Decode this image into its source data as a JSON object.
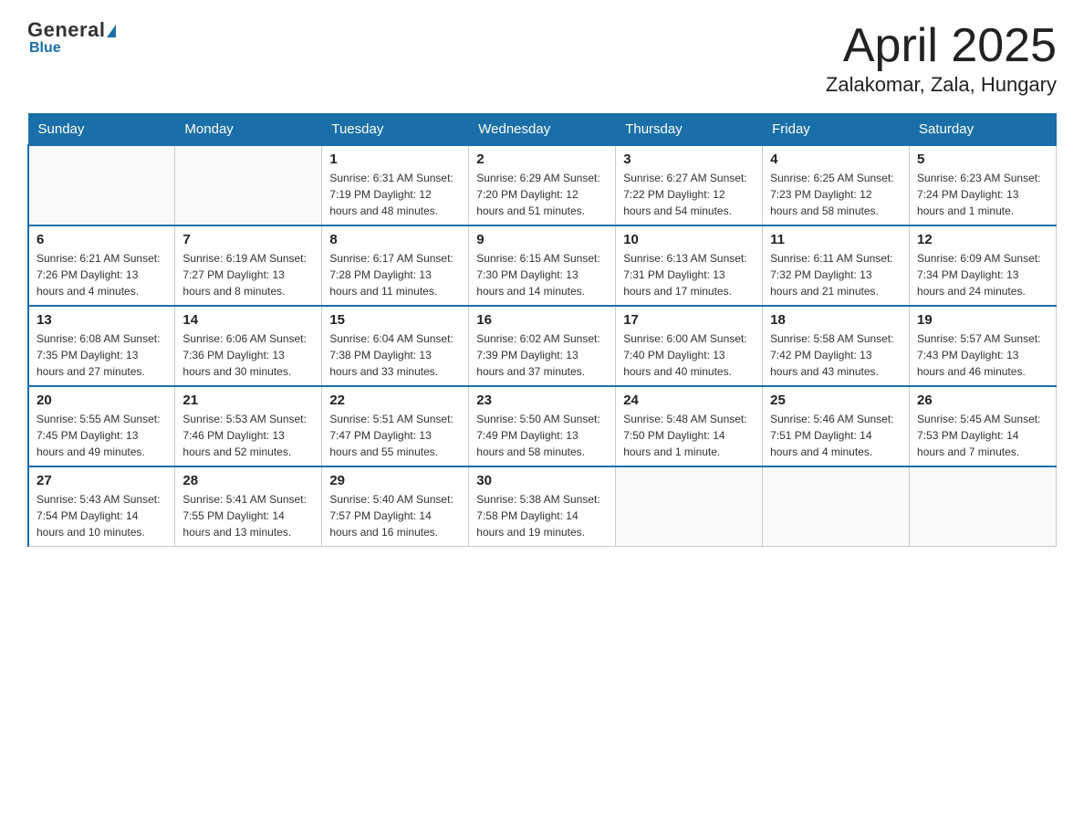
{
  "header": {
    "logo_top": "General",
    "logo_blue": "Blue",
    "title": "April 2025",
    "subtitle": "Zalakomar, Zala, Hungary"
  },
  "days_of_week": [
    "Sunday",
    "Monday",
    "Tuesday",
    "Wednesday",
    "Thursday",
    "Friday",
    "Saturday"
  ],
  "weeks": [
    [
      {
        "day": "",
        "info": ""
      },
      {
        "day": "",
        "info": ""
      },
      {
        "day": "1",
        "info": "Sunrise: 6:31 AM\nSunset: 7:19 PM\nDaylight: 12 hours\nand 48 minutes."
      },
      {
        "day": "2",
        "info": "Sunrise: 6:29 AM\nSunset: 7:20 PM\nDaylight: 12 hours\nand 51 minutes."
      },
      {
        "day": "3",
        "info": "Sunrise: 6:27 AM\nSunset: 7:22 PM\nDaylight: 12 hours\nand 54 minutes."
      },
      {
        "day": "4",
        "info": "Sunrise: 6:25 AM\nSunset: 7:23 PM\nDaylight: 12 hours\nand 58 minutes."
      },
      {
        "day": "5",
        "info": "Sunrise: 6:23 AM\nSunset: 7:24 PM\nDaylight: 13 hours\nand 1 minute."
      }
    ],
    [
      {
        "day": "6",
        "info": "Sunrise: 6:21 AM\nSunset: 7:26 PM\nDaylight: 13 hours\nand 4 minutes."
      },
      {
        "day": "7",
        "info": "Sunrise: 6:19 AM\nSunset: 7:27 PM\nDaylight: 13 hours\nand 8 minutes."
      },
      {
        "day": "8",
        "info": "Sunrise: 6:17 AM\nSunset: 7:28 PM\nDaylight: 13 hours\nand 11 minutes."
      },
      {
        "day": "9",
        "info": "Sunrise: 6:15 AM\nSunset: 7:30 PM\nDaylight: 13 hours\nand 14 minutes."
      },
      {
        "day": "10",
        "info": "Sunrise: 6:13 AM\nSunset: 7:31 PM\nDaylight: 13 hours\nand 17 minutes."
      },
      {
        "day": "11",
        "info": "Sunrise: 6:11 AM\nSunset: 7:32 PM\nDaylight: 13 hours\nand 21 minutes."
      },
      {
        "day": "12",
        "info": "Sunrise: 6:09 AM\nSunset: 7:34 PM\nDaylight: 13 hours\nand 24 minutes."
      }
    ],
    [
      {
        "day": "13",
        "info": "Sunrise: 6:08 AM\nSunset: 7:35 PM\nDaylight: 13 hours\nand 27 minutes."
      },
      {
        "day": "14",
        "info": "Sunrise: 6:06 AM\nSunset: 7:36 PM\nDaylight: 13 hours\nand 30 minutes."
      },
      {
        "day": "15",
        "info": "Sunrise: 6:04 AM\nSunset: 7:38 PM\nDaylight: 13 hours\nand 33 minutes."
      },
      {
        "day": "16",
        "info": "Sunrise: 6:02 AM\nSunset: 7:39 PM\nDaylight: 13 hours\nand 37 minutes."
      },
      {
        "day": "17",
        "info": "Sunrise: 6:00 AM\nSunset: 7:40 PM\nDaylight: 13 hours\nand 40 minutes."
      },
      {
        "day": "18",
        "info": "Sunrise: 5:58 AM\nSunset: 7:42 PM\nDaylight: 13 hours\nand 43 minutes."
      },
      {
        "day": "19",
        "info": "Sunrise: 5:57 AM\nSunset: 7:43 PM\nDaylight: 13 hours\nand 46 minutes."
      }
    ],
    [
      {
        "day": "20",
        "info": "Sunrise: 5:55 AM\nSunset: 7:45 PM\nDaylight: 13 hours\nand 49 minutes."
      },
      {
        "day": "21",
        "info": "Sunrise: 5:53 AM\nSunset: 7:46 PM\nDaylight: 13 hours\nand 52 minutes."
      },
      {
        "day": "22",
        "info": "Sunrise: 5:51 AM\nSunset: 7:47 PM\nDaylight: 13 hours\nand 55 minutes."
      },
      {
        "day": "23",
        "info": "Sunrise: 5:50 AM\nSunset: 7:49 PM\nDaylight: 13 hours\nand 58 minutes."
      },
      {
        "day": "24",
        "info": "Sunrise: 5:48 AM\nSunset: 7:50 PM\nDaylight: 14 hours\nand 1 minute."
      },
      {
        "day": "25",
        "info": "Sunrise: 5:46 AM\nSunset: 7:51 PM\nDaylight: 14 hours\nand 4 minutes."
      },
      {
        "day": "26",
        "info": "Sunrise: 5:45 AM\nSunset: 7:53 PM\nDaylight: 14 hours\nand 7 minutes."
      }
    ],
    [
      {
        "day": "27",
        "info": "Sunrise: 5:43 AM\nSunset: 7:54 PM\nDaylight: 14 hours\nand 10 minutes."
      },
      {
        "day": "28",
        "info": "Sunrise: 5:41 AM\nSunset: 7:55 PM\nDaylight: 14 hours\nand 13 minutes."
      },
      {
        "day": "29",
        "info": "Sunrise: 5:40 AM\nSunset: 7:57 PM\nDaylight: 14 hours\nand 16 minutes."
      },
      {
        "day": "30",
        "info": "Sunrise: 5:38 AM\nSunset: 7:58 PM\nDaylight: 14 hours\nand 19 minutes."
      },
      {
        "day": "",
        "info": ""
      },
      {
        "day": "",
        "info": ""
      },
      {
        "day": "",
        "info": ""
      }
    ]
  ]
}
